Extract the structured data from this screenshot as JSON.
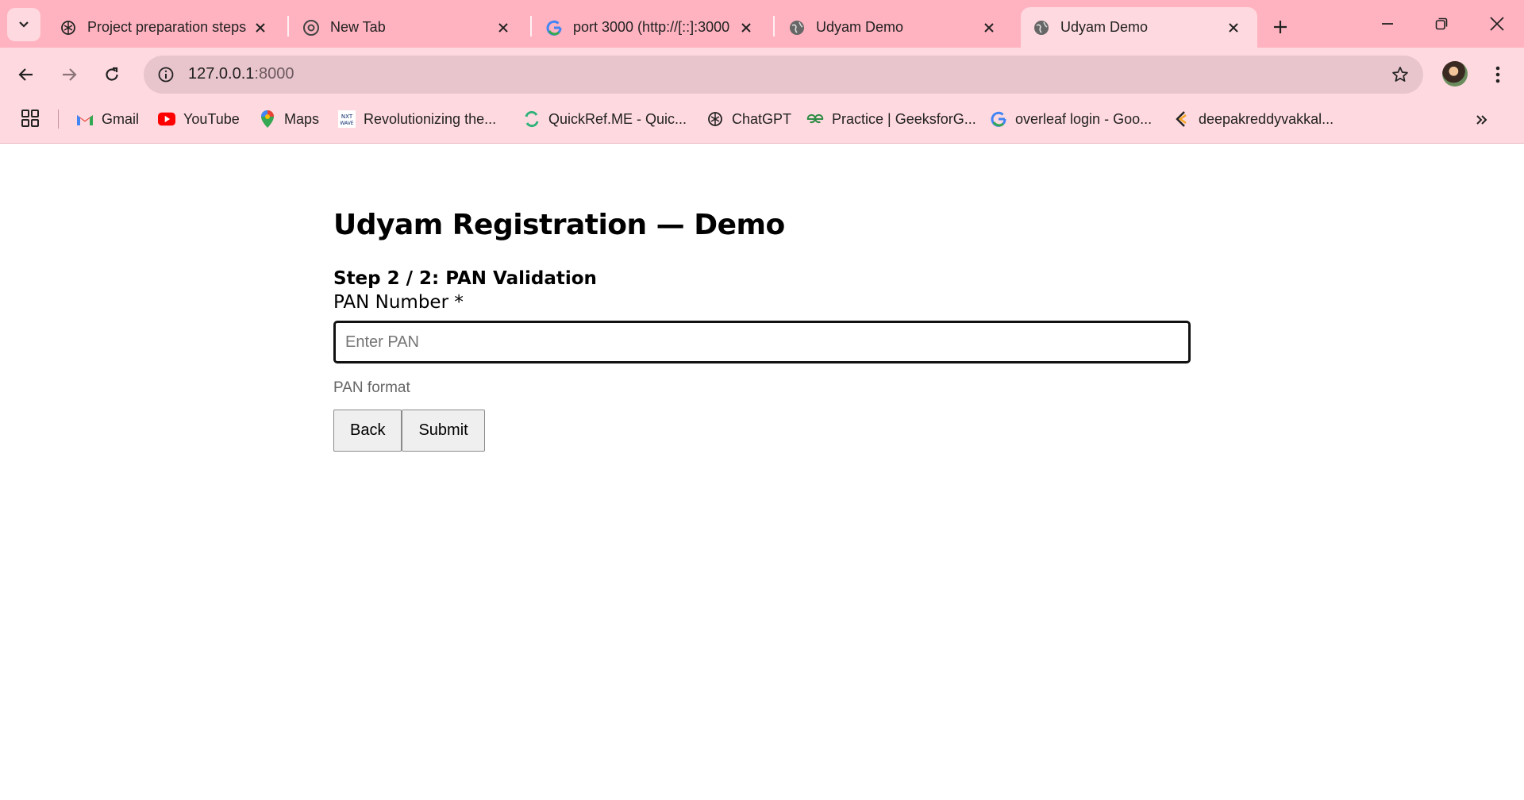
{
  "browser": {
    "tabs": [
      {
        "title": "Project preparation steps",
        "favicon": "chatgpt-icon",
        "active": false
      },
      {
        "title": "New Tab",
        "favicon": "chrome-icon",
        "active": false
      },
      {
        "title": "port 3000 (http://[::]:3000",
        "favicon": "google-icon",
        "active": false
      },
      {
        "title": "Udyam Demo",
        "favicon": "globe-icon",
        "active": false
      },
      {
        "title": "Udyam Demo",
        "favicon": "globe-icon",
        "active": true
      }
    ],
    "address": {
      "host": "127.0.0.1",
      "port": ":8000"
    },
    "bookmarks": [
      {
        "label": "Gmail",
        "icon": "gmail-icon"
      },
      {
        "label": "YouTube",
        "icon": "youtube-icon"
      },
      {
        "label": "Maps",
        "icon": "maps-icon"
      },
      {
        "label": "Revolutionizing the...",
        "icon": "nxtwave-icon"
      },
      {
        "label": "QuickRef.ME - Quic...",
        "icon": "quickref-icon"
      },
      {
        "label": "ChatGPT",
        "icon": "chatgpt-icon"
      },
      {
        "label": "Practice | GeeksforG...",
        "icon": "gfg-icon"
      },
      {
        "label": "overleaf login - Goo...",
        "icon": "google-icon"
      },
      {
        "label": "deepakreddyvakkal...",
        "icon": "portfolio-icon"
      }
    ],
    "colors": {
      "frame": "#ffb3c0",
      "toolbar": "#ffd9e0",
      "omnibox": "#e8c4cc"
    }
  },
  "page": {
    "title": "Udyam Registration — Demo",
    "step": "Step 2 / 2: PAN Validation",
    "field_label": "PAN Number *",
    "field_placeholder": "Enter PAN",
    "field_value": "",
    "hint": "PAN format",
    "back_label": "Back",
    "submit_label": "Submit"
  }
}
